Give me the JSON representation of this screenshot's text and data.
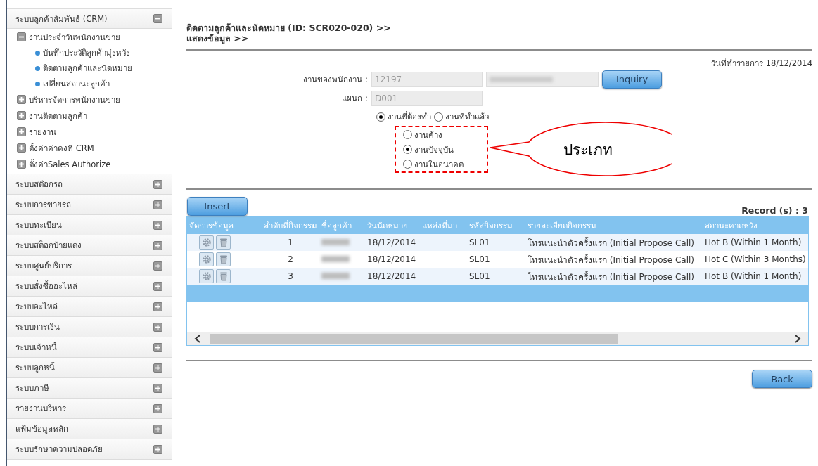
{
  "sidebar": {
    "sections": [
      {
        "label": "ระบบลูกค้าสัมพันธ์ (CRM)",
        "expanded": true,
        "children": [
          {
            "label": "งานประจำวันพนักงานขาย",
            "expanded": true,
            "children": [
              {
                "label": "บันทึกประวัติลูกค้ามุ่งหวัง"
              },
              {
                "label": "ติดตามลูกค้าและนัดหมาย"
              },
              {
                "label": "เปลี่ยนสถานะลูกค้า"
              }
            ]
          },
          {
            "label": "บริหารจัดการพนักงานขาย",
            "expanded": false
          },
          {
            "label": "งานติดตามลูกค้า",
            "expanded": false
          },
          {
            "label": "รายงาน",
            "expanded": false
          },
          {
            "label": "ตั้งค่าค่าคงที่ CRM",
            "expanded": false
          },
          {
            "label": "ตั้งค่าSales Authorize",
            "expanded": false
          }
        ]
      },
      {
        "label": "ระบบสต๊อกรถ",
        "expanded": false
      },
      {
        "label": "ระบบการขายรถ",
        "expanded": false
      },
      {
        "label": "ระบบทะเบียน",
        "expanded": false
      },
      {
        "label": "ระบบสต็อกป้ายแดง",
        "expanded": false
      },
      {
        "label": "ระบบศูนย์บริการ",
        "expanded": false
      },
      {
        "label": "ระบบสั่งซื้ออะไหล่",
        "expanded": false
      },
      {
        "label": "ระบบอะไหล่",
        "expanded": false
      },
      {
        "label": "ระบบการเงิน",
        "expanded": false
      },
      {
        "label": "ระบบเจ้าหนี้",
        "expanded": false
      },
      {
        "label": "ระบบลูกหนี้",
        "expanded": false
      },
      {
        "label": "ระบบภาษี",
        "expanded": false
      },
      {
        "label": "รายงานบริหาร",
        "expanded": false
      },
      {
        "label": "แฟ้มข้อมูลหลัก",
        "expanded": false
      },
      {
        "label": "ระบบรักษาความปลอดภัย",
        "expanded": false
      }
    ]
  },
  "header": {
    "title": "ติดตามลูกค้าและนัดหมาย (ID: SCR020-020) >>",
    "subtitle": "แสดงข้อมูล >>"
  },
  "transaction_date": "วันที่ทำรายการ 18/12/2014",
  "form": {
    "employee_label": "งานของพนักงาน :",
    "employee_value": "12197",
    "employee_name_redacted": true,
    "inquiry_button": "Inquiry",
    "department_label": "แผนก :",
    "department_value": "D001",
    "work_status": [
      {
        "label": "งานที่ต้องทำ",
        "selected": true
      },
      {
        "label": "งานที่ทำแล้ว",
        "selected": false
      }
    ],
    "job_type": [
      {
        "label": "งานค้าง",
        "selected": false
      },
      {
        "label": "งานปัจจุบัน",
        "selected": true
      },
      {
        "label": "งานในอนาคต",
        "selected": false
      }
    ]
  },
  "callout": {
    "text": "ประเภท"
  },
  "insert_button": "Insert",
  "record_count": "Record (s) : 3",
  "table": {
    "columns": [
      "จัดการข้อมูล",
      "ลำดับที่กิจกรรม",
      "ชื่อลูกค้า",
      "วันนัดหมาย",
      "แหล่งที่มา",
      "รหัสกิจกรรม",
      "รายละเอียดกิจกรรม",
      "สถานะคาดหวัง"
    ],
    "rows": [
      {
        "seq": "1",
        "name_redacted": true,
        "date": "18/12/2014",
        "activity_code": "SL01",
        "detail": "โทรแนะนำตัวครั้งแรก (Initial Propose Call)",
        "status": "Hot B (Within 1 Month)"
      },
      {
        "seq": "2",
        "name_redacted": true,
        "date": "18/12/2014",
        "activity_code": "SL01",
        "detail": "โทรแนะนำตัวครั้งแรก (Initial Propose Call)",
        "status": "Hot C (Within 3 Months)"
      },
      {
        "seq": "3",
        "name_redacted": true,
        "date": "18/12/2014",
        "activity_code": "SL01",
        "detail": "โทรแนะนำตัวครั้งแรก (Initial Propose Call)",
        "status": "Hot B (Within 1 Month)"
      }
    ]
  },
  "back_button": "Back"
}
